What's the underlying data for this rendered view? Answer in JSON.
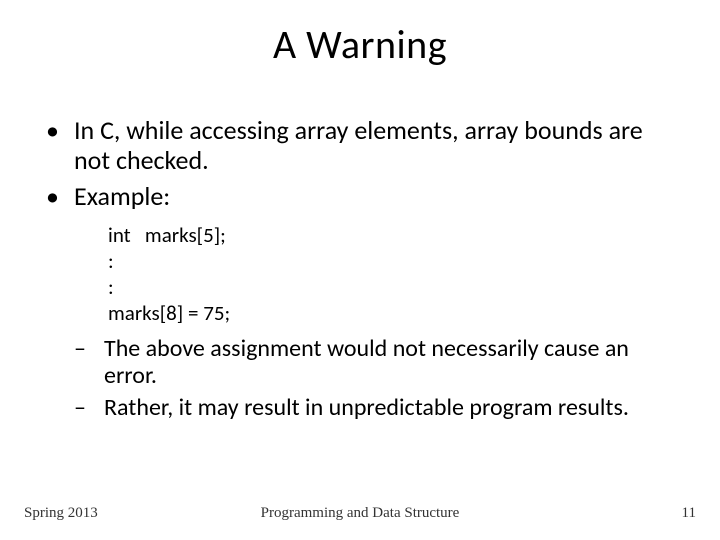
{
  "title": "A Warning",
  "bullets": [
    "In C, while accessing array elements, array bounds are not checked.",
    "Example:"
  ],
  "code": {
    "l1": "int   marks[5];",
    "l2": ":",
    "l3": ":",
    "l4": "marks[8] = 75;"
  },
  "subbullets": [
    "The above assignment would not necessarily cause an error.",
    "Rather, it may result in unpredictable program results."
  ],
  "footer": {
    "left": "Spring 2013",
    "center": "Programming and Data Structure",
    "right": "11"
  }
}
